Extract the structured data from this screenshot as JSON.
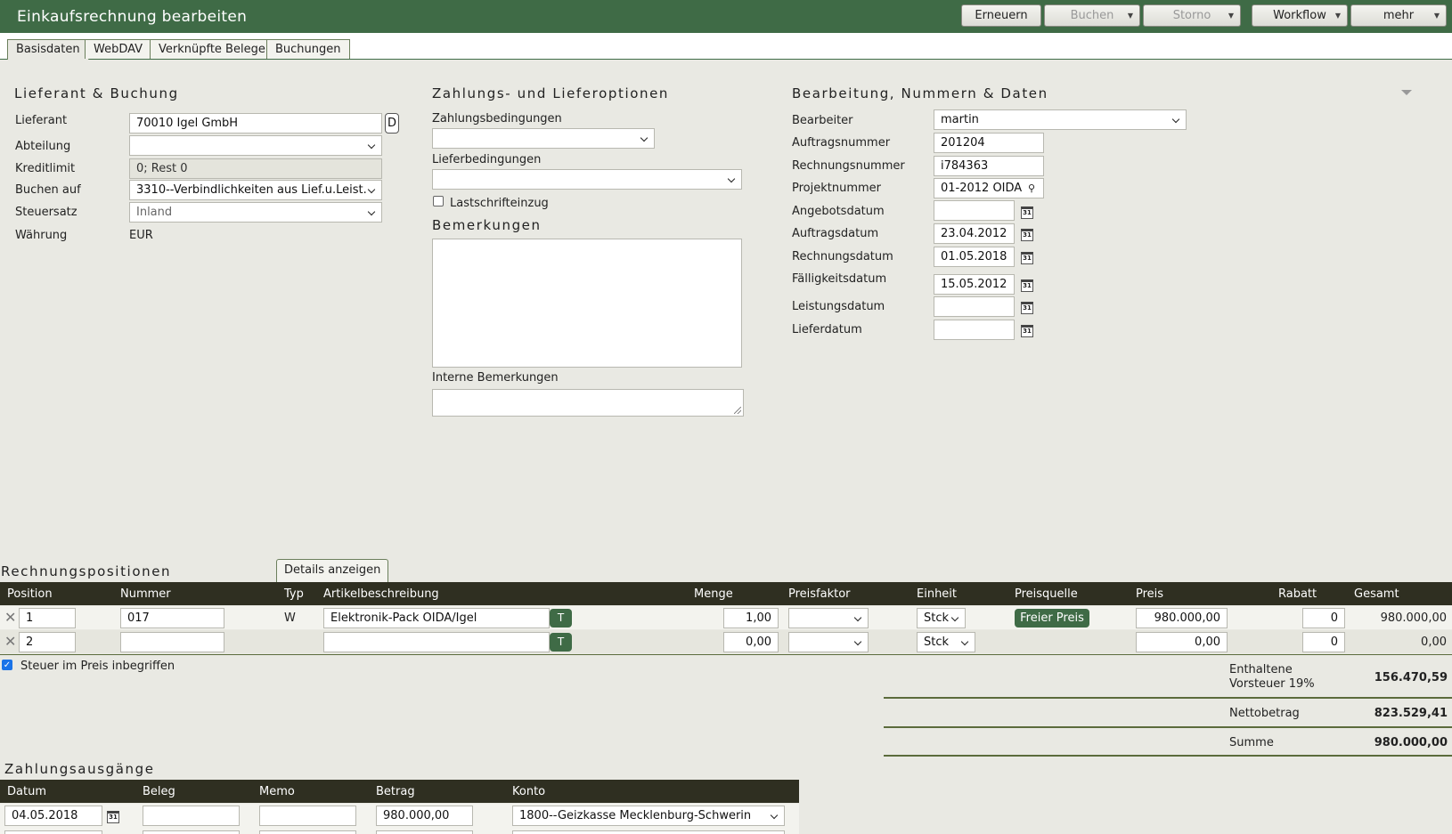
{
  "window": {
    "title": "Einkaufsrechnung bearbeiten"
  },
  "toolbar": {
    "erneuern": "Erneuern",
    "buchen": "Buchen",
    "storno": "Storno",
    "workflow": "Workflow",
    "mehr": "mehr"
  },
  "tabs": [
    "Basisdaten",
    "WebDAV",
    "Verknüpfte Belege",
    "Buchungen"
  ],
  "lieferant_section": {
    "title": "Lieferant & Buchung",
    "lieferant_label": "Lieferant",
    "lieferant_value": "70010 Igel GmbH",
    "lieferant_btn": "D",
    "abteilung_label": "Abteilung",
    "abteilung_value": "",
    "kreditlimit_label": "Kreditlimit",
    "kreditlimit_value": "0; Rest 0",
    "buchen_label": "Buchen auf",
    "buchen_value": "3310--Verbindlichkeiten aus Lief.u.Leist.",
    "steuersatz_label": "Steuersatz",
    "steuersatz_value": "Inland",
    "waehrung_label": "Währung",
    "waehrung_value": "EUR"
  },
  "zahlung_section": {
    "title": "Zahlungs- und Lieferoptionen",
    "zahlungsbed_label": "Zahlungsbedingungen",
    "zahlungsbed_value": "",
    "lieferbed_label": "Lieferbedingungen",
    "lieferbed_value": "",
    "lastschrift_label": "Lastschrifteinzug",
    "bemerkungen_title": "Bemerkungen",
    "interne_label": "Interne Bemerkungen"
  },
  "bearbeitung_section": {
    "title": "Bearbeitung, Nummern & Daten",
    "bearbeiter_label": "Bearbeiter",
    "bearbeiter_value": "martin",
    "auftragsnummer_label": "Auftragsnummer",
    "auftragsnummer_value": "201204",
    "rechnungsnummer_label": "Rechnungsnummer",
    "rechnungsnummer_value": "i784363",
    "projektnummer_label": "Projektnummer",
    "projektnummer_value": "01-2012 OIDA",
    "angebotsdatum_label": "Angebotsdatum",
    "angebotsdatum_value": "",
    "auftragsdatum_label": "Auftragsdatum",
    "auftragsdatum_value": "23.04.2012",
    "rechnungsdatum_label": "Rechnungsdatum",
    "rechnungsdatum_value": "01.05.2018",
    "faelligkeitsdatum_label": "Fälligkeitsdatum",
    "faelligkeitsdatum_value": "15.05.2012",
    "leistungsdatum_label": "Leistungsdatum",
    "leistungsdatum_value": "",
    "lieferdatum_label": "Lieferdatum",
    "lieferdatum_value": ""
  },
  "positions": {
    "title": "Rechnungspositionen",
    "details_tab": "Details anzeigen",
    "headers": {
      "position": "Position",
      "nummer": "Nummer",
      "typ": "Typ",
      "artikel": "Artikelbeschreibung",
      "menge": "Menge",
      "preisfaktor": "Preisfaktor",
      "einheit": "Einheit",
      "preisquelle": "Preisquelle",
      "preis": "Preis",
      "rabatt": "Rabatt",
      "gesamt": "Gesamt"
    },
    "rows": [
      {
        "position": "1",
        "nummer": "017",
        "typ": "W",
        "artikel": "Elektronik-Pack OIDA/Igel",
        "t": "T",
        "menge": "1,00",
        "preisfaktor": "",
        "einheit": "Stck",
        "preisquelle": "Freier Preis",
        "preis": "980.000,00",
        "rabatt": "0",
        "gesamt": "980.000,00"
      },
      {
        "position": "2",
        "nummer": "",
        "typ": "",
        "artikel": "",
        "t": "T",
        "menge": "0,00",
        "preisfaktor": "",
        "einheit": "Stck",
        "preisquelle": "",
        "preis": "0,00",
        "rabatt": "0",
        "gesamt": "0,00"
      }
    ],
    "steuer_label": "Steuer im Preis inbegriffen",
    "totals": {
      "vorsteuer_label_1": "Enthaltene",
      "vorsteuer_label_2": "Vorsteuer 19%",
      "vorsteuer_value": "156.470,59",
      "netto_label": "Nettobetrag",
      "netto_value": "823.529,41",
      "summe_label": "Summe",
      "summe_value": "980.000,00"
    }
  },
  "payments": {
    "title": "Zahlungsausgänge",
    "headers": {
      "datum": "Datum",
      "beleg": "Beleg",
      "memo": "Memo",
      "betrag": "Betrag",
      "konto": "Konto"
    },
    "rows": [
      {
        "datum": "04.05.2018",
        "beleg": "",
        "memo": "",
        "betrag": "980.000,00",
        "konto": "1800--Geizkasse Mecklenburg-Schwerin"
      }
    ]
  }
}
